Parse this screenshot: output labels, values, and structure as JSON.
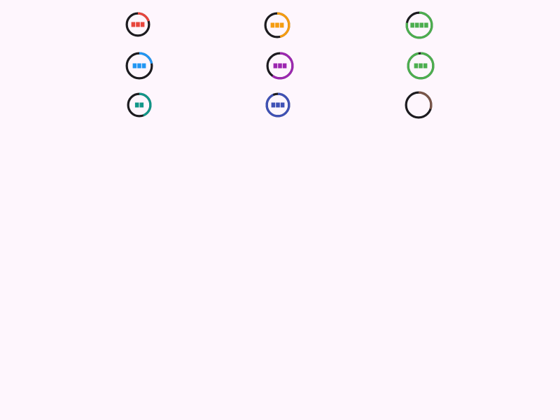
{
  "track_color": "#1c1b1f",
  "indicators": [
    {
      "name": "progress-indicator-red",
      "color": "#e8453c",
      "progress": 0.2,
      "bars": 3
    },
    {
      "name": "progress-indicator-orange",
      "color": "#f59c10",
      "progress": 0.46,
      "bars": 3
    },
    {
      "name": "progress-indicator-green",
      "color": "#4cae4f",
      "progress": 0.78,
      "bars": 4
    },
    {
      "name": "progress-indicator-blue",
      "color": "#2196f3",
      "progress": 0.22,
      "bars": 3
    },
    {
      "name": "progress-indicator-purple",
      "color": "#9c27b0",
      "progress": 0.6,
      "bars": 3
    },
    {
      "name": "progress-indicator-green-2",
      "color": "#4cae4f",
      "progress": 0.97,
      "bars": 3
    },
    {
      "name": "progress-indicator-teal",
      "color": "#119688",
      "progress": 0.44,
      "bars": 2
    },
    {
      "name": "progress-indicator-indigo",
      "color": "#3f51b5",
      "progress": 0.93,
      "bars": 3
    },
    {
      "name": "progress-indicator-brown",
      "color": "#795548",
      "progress": 0.3,
      "bars": 0
    }
  ]
}
